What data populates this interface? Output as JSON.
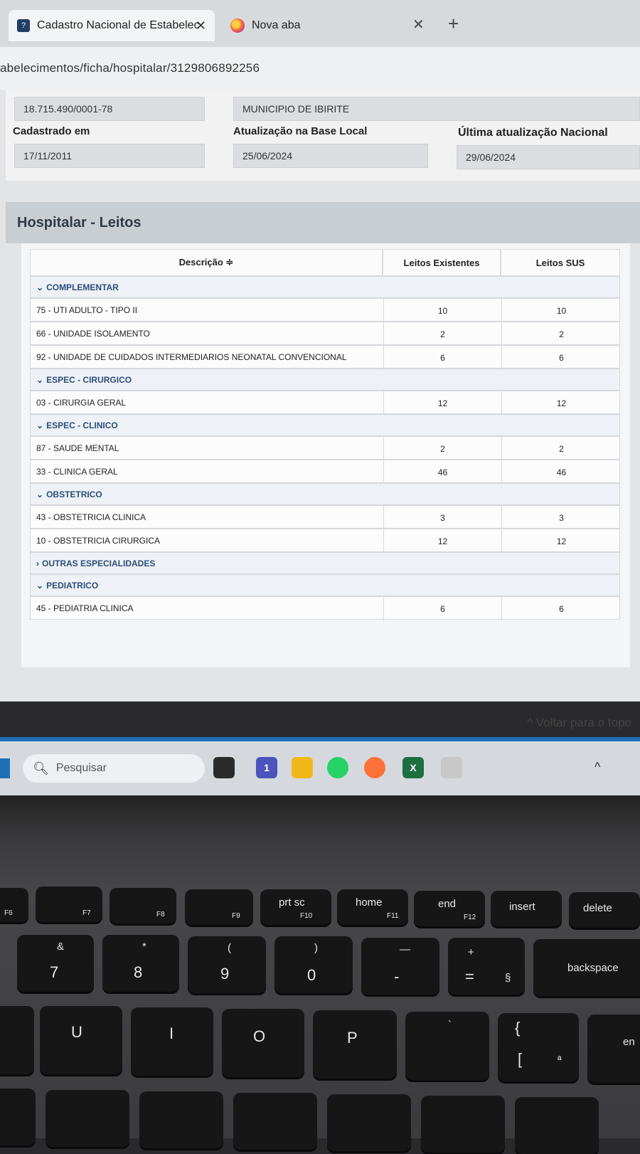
{
  "browser": {
    "active_tab_title": "Cadastro Nacional de Estabelec",
    "active_tab_close": "✕",
    "inactive_tab_title": "Nova aba",
    "tab_close": "✕",
    "new_tab": "+",
    "url": "abelecimentos/ficha/hospitalar/3129806892256"
  },
  "info": {
    "cnpj": "18.715.490/0001-78",
    "municipio": "MUNICIPIO DE IBIRITE",
    "cadastrado_label": "Cadastrado em",
    "cadastrado_value": "17/11/2011",
    "atualizacao_local_label": "Atualização na Base Local",
    "atualizacao_local_value": "25/06/2024",
    "atualizacao_nacional_label": "Última atualização Nacional",
    "atualizacao_nacional_value": "29/06/2024"
  },
  "section": {
    "title": "Hospitalar - Leitos"
  },
  "table": {
    "headers": {
      "descricao": "Descrição ≑",
      "existentes": "Leitos Existentes",
      "sus": "Leitos SUS"
    },
    "groups": [
      {
        "label": "COMPLEMENTAR",
        "expanded": true,
        "chevron": "⌄"
      },
      {
        "label": "ESPEC - CIRURGICO",
        "expanded": true,
        "chevron": "⌄"
      },
      {
        "label": "ESPEC - CLINICO",
        "expanded": true,
        "chevron": "⌄"
      },
      {
        "label": "OBSTETRICO",
        "expanded": true,
        "chevron": "⌄"
      },
      {
        "label": "OUTRAS ESPECIALIDADES",
        "expanded": false,
        "chevron": "›"
      },
      {
        "label": "PEDIATRICO",
        "expanded": true,
        "chevron": "⌄"
      }
    ],
    "rows": [
      {
        "desc": "75 - UTI ADULTO - TIPO II",
        "existentes": "10",
        "sus": "10"
      },
      {
        "desc": "66 - UNIDADE ISOLAMENTO",
        "existentes": "2",
        "sus": "2"
      },
      {
        "desc": "92 - UNIDADE DE CUIDADOS INTERMEDIARIOS NEONATAL CONVENCIONAL",
        "existentes": "6",
        "sus": "6"
      },
      {
        "desc": "03 - CIRURGIA GERAL",
        "existentes": "12",
        "sus": "12"
      },
      {
        "desc": "87 - SAUDE MENTAL",
        "existentes": "2",
        "sus": "2"
      },
      {
        "desc": "33 - CLINICA GERAL",
        "existentes": "46",
        "sus": "46"
      },
      {
        "desc": "43 - OBSTETRICIA CLINICA",
        "existentes": "3",
        "sus": "3"
      },
      {
        "desc": "10 - OBSTETRICIA CIRURGICA",
        "existentes": "12",
        "sus": "12"
      },
      {
        "desc": "45 - PEDIATRIA CLINICA",
        "existentes": "6",
        "sus": "6"
      }
    ]
  },
  "back_to_top": "^ Voltar para o topo",
  "taskbar": {
    "search_placeholder": "Pesquisar",
    "teams_badge": "1",
    "excel_label": "X"
  },
  "keyboard": {
    "fn_row": [
      "F6",
      "F7",
      "F8",
      "F9",
      "prt sc",
      "F10",
      "home",
      "F11",
      "end",
      "F12",
      "insert",
      "delete"
    ],
    "num_row": [
      {
        "top": "&",
        "bottom": "7"
      },
      {
        "top": "*",
        "bottom": "8"
      },
      {
        "top": "(",
        "bottom": "9"
      },
      {
        "top": ")",
        "bottom": "0"
      },
      {
        "top": "—",
        "bottom": "-"
      },
      {
        "top": "+",
        "bottom": "="
      },
      {
        "top": "",
        "bottom": "§"
      },
      {
        "top": "",
        "bottom": "backspace"
      }
    ],
    "letter_row": [
      "U",
      "I",
      "O",
      "P",
      "`",
      "{",
      "[",
      "ª",
      "en"
    ]
  }
}
